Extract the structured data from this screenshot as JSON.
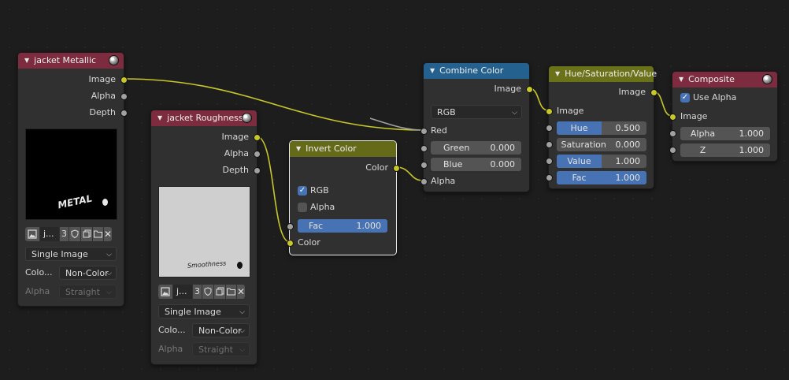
{
  "colors": {
    "background": "#1d1d1d",
    "node_body": "#303030",
    "header_image": "#7d2b3e",
    "header_converter": "#24618e",
    "header_color": "#646a17",
    "socket_color": "#c7c729",
    "socket_value": "#a1a1a1",
    "slider_fill": "#4772b3"
  },
  "nodes": {
    "metallic": {
      "title": "jacket Metallic",
      "outputs": [
        "Image",
        "Alpha",
        "Depth"
      ],
      "preview_text": "METAL",
      "image_name": "j...",
      "users": "3",
      "source": "Single Image",
      "color_label": "Colo...",
      "color_value": "Non-Color",
      "alpha_label": "Alpha",
      "alpha_value": "Straight"
    },
    "roughness": {
      "title": "jacket Roughness",
      "outputs": [
        "Image",
        "Alpha",
        "Depth"
      ],
      "preview_text": "Smoothness",
      "image_name": "j...",
      "users": "3",
      "source": "Single Image",
      "color_label": "Colo...",
      "color_value": "Non-Color",
      "alpha_label": "Alpha",
      "alpha_value": "Straight"
    },
    "invert": {
      "title": "Invert Color",
      "output": "Color",
      "rgb_label": "RGB",
      "rgb_checked": true,
      "alpha_label": "Alpha",
      "alpha_checked": false,
      "fac_label": "Fac",
      "fac_value": "1.000",
      "fac_fraction": 1.0,
      "input": "Color"
    },
    "combine": {
      "title": "Combine Color",
      "output": "Image",
      "mode": "RGB",
      "red_label": "Red",
      "green_label": "Green",
      "green_value": "0.000",
      "blue_label": "Blue",
      "blue_value": "0.000",
      "alpha_label": "Alpha"
    },
    "hsv": {
      "title": "Hue/Saturation/Value",
      "output": "Image",
      "input": "Image",
      "hue_label": "Hue",
      "hue_value": "0.500",
      "hue_fraction": 0.5,
      "saturation_label": "Saturation",
      "saturation_value": "0.000",
      "saturation_fraction": 0.0,
      "value_label": "Value",
      "value_value": "1.000",
      "value_fraction": 0.5,
      "fac_label": "Fac",
      "fac_value": "1.000",
      "fac_fraction": 1.0
    },
    "composite": {
      "title": "Composite",
      "use_alpha_label": "Use Alpha",
      "use_alpha_checked": true,
      "image_label": "Image",
      "alpha_label": "Alpha",
      "alpha_value": "1.000",
      "z_label": "Z",
      "z_value": "1.000"
    }
  }
}
